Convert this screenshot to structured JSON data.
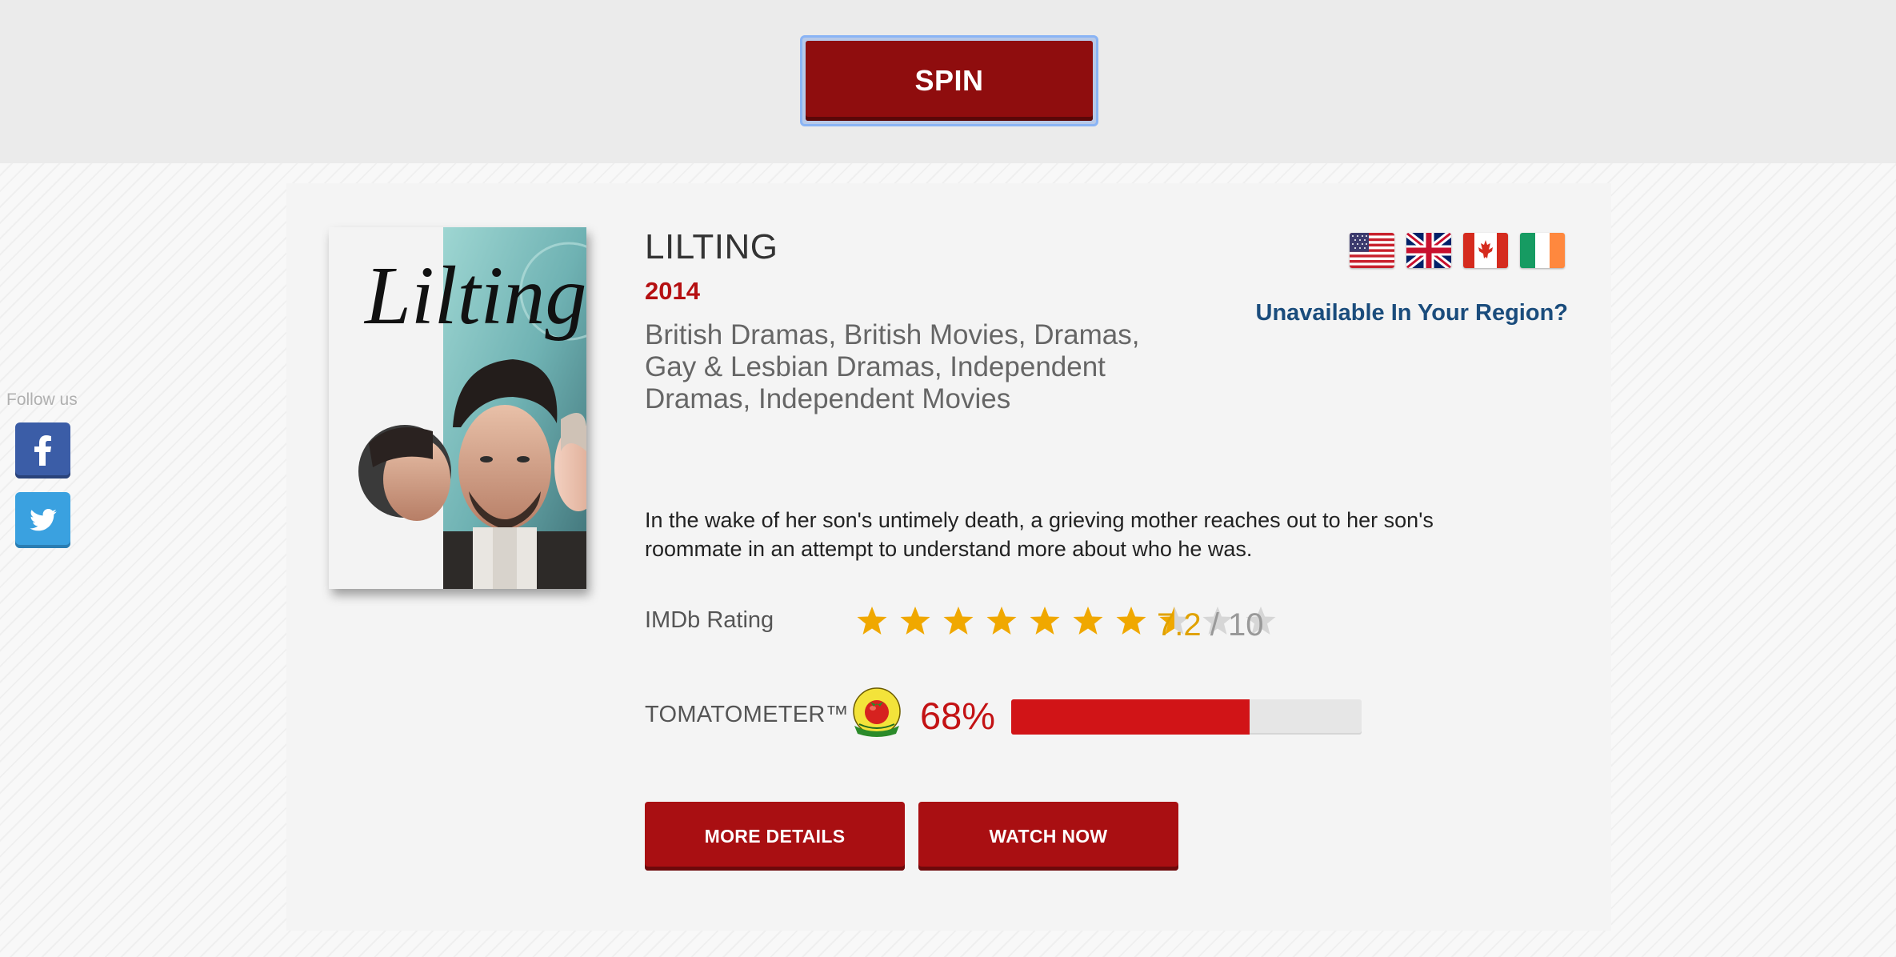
{
  "spin": {
    "label": "SPIN"
  },
  "movie": {
    "title": "LILTING",
    "year": "2014",
    "genres": "British Dramas, British Movies, Dramas, Gay & Lesbian Dramas, Independent Dramas, Independent Movies",
    "description": "In the wake of her son's untimely death, a grieving mother reaches out to her son's roommate in an attempt to understand more about who he was.",
    "poster_title": "Lilting"
  },
  "availability": {
    "flags": [
      "us-flag",
      "uk-flag",
      "canada-flag",
      "ireland-flag"
    ],
    "region_link": "Unavailable In Your Region?"
  },
  "imdb": {
    "label": "IMDb Rating",
    "rating": "7.2",
    "separator": "/",
    "max": "10",
    "stars_total": 10,
    "stars_filled": 7.5,
    "star_color": "#f0a800"
  },
  "tomatometer": {
    "label": "TOMATOMETER™",
    "percent_text": "68%",
    "percent_value": 68,
    "icon": "tomato-icon"
  },
  "actions": {
    "more_details": "MORE DETAILS",
    "watch_now": "WATCH NOW"
  },
  "social": {
    "follow_label": "Follow us",
    "icons": [
      "facebook-icon",
      "twitter-icon"
    ]
  },
  "colors": {
    "brand_red": "#8f0d0e",
    "region_link": "#1a4c7c",
    "tomato_red": "#c31214"
  }
}
